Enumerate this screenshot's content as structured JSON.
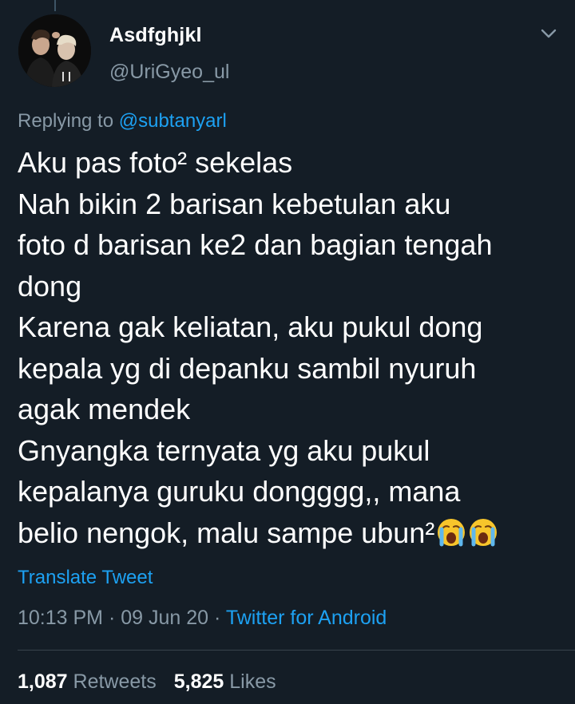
{
  "tweet": {
    "display_name": "Asdfghjkl",
    "handle": "@UriGyeo_ul",
    "replying_prefix": "Replying to",
    "replying_to": "@subtanyarl",
    "lines": [
      "Aku pas foto² sekelas",
      "Nah bikin 2 barisan kebetulan aku",
      "foto d barisan ke2 dan bagian tengah",
      "dong",
      "Karena gak keliatan, aku pukul dong",
      "kepala yg di depanku sambil nyuruh",
      "agak mendek",
      "Gnyangka ternyata yg aku pukul",
      "kepalanya guruku dongggg,, mana",
      "belio nengok, malu sampe ubun²"
    ],
    "emojis": [
      "crying-face-emoji",
      "crying-face-emoji"
    ],
    "translate_label": "Translate Tweet",
    "time": "10:13 PM",
    "date": "09 Jun 20",
    "separator": "·",
    "source": "Twitter for Android"
  },
  "stats": {
    "retweets_count": "1,087",
    "retweets_label": "Retweets",
    "likes_count": "5,825",
    "likes_label": "Likes"
  },
  "colors": {
    "background": "#141d26",
    "text_primary": "#ffffff",
    "text_secondary": "#8899a6",
    "link": "#1da1f2",
    "divider": "#38444d"
  },
  "icons": {
    "menu": "chevron-down-icon"
  }
}
